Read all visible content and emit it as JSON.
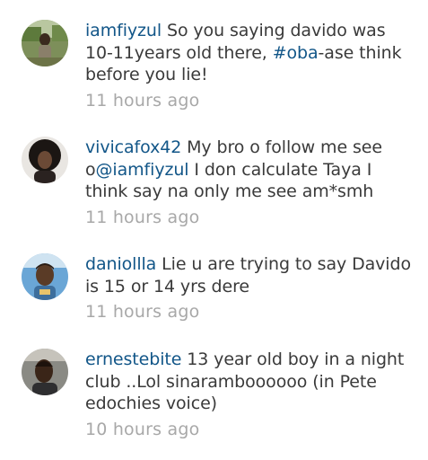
{
  "colors": {
    "username": "#125688",
    "link": "#125688",
    "text": "#3a3a3a",
    "timestamp": "#a8a8a8",
    "background": "#ffffff"
  },
  "comments": [
    {
      "username": "iamfiyzul",
      "text_before": " So you saying davido was 10-11years old there, ",
      "link": "#oba",
      "text_after": "-ase think before you lie!",
      "timestamp": "11 hours ago",
      "avatar_icon": "avatar-photo-outdoor"
    },
    {
      "username": "vivicafox42",
      "text_before": " My bro o follow me see o",
      "link": "@iamfiyzul",
      "text_after": " I don calculate Taya I think say na only me see am*smh",
      "timestamp": "11 hours ago",
      "avatar_icon": "avatar-photo-afro"
    },
    {
      "username": "daniollla",
      "text_before": " Lie u are trying to say Davido is 15 or 14 yrs dere",
      "link": "",
      "text_after": "",
      "timestamp": "11 hours ago",
      "avatar_icon": "avatar-photo-portrait"
    },
    {
      "username": "ernestebite",
      "text_before": " 13 year old boy in a night club ..Lol sinaramboooooo (in Pete edochies voice)",
      "link": "",
      "text_after": "",
      "timestamp": "10 hours ago",
      "avatar_icon": "avatar-photo-selfie"
    }
  ]
}
